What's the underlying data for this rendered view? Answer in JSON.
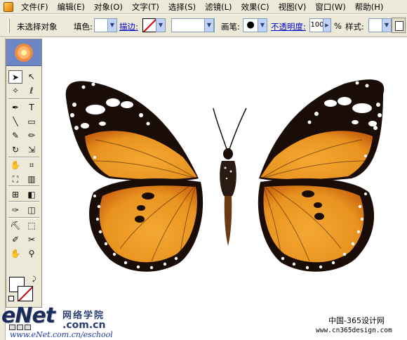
{
  "menubar": {
    "items": [
      "文件(F)",
      "编辑(E)",
      "对象(O)",
      "文字(T)",
      "选择(S)",
      "滤镜(L)",
      "效果(C)",
      "视图(V)",
      "窗口(W)",
      "帮助(H)"
    ]
  },
  "controlbar": {
    "selection_status": "未选择对象",
    "fill_label": "填色:",
    "stroke_label": "描边:",
    "brush_label": "画笔:",
    "brush_glyph": "●",
    "opacity_label": "不透明度:",
    "opacity_value": "100",
    "percent": "%",
    "style_label": "样式:"
  },
  "toolbox": {
    "tools": [
      {
        "name": "selection-tool-icon",
        "glyph": "➤"
      },
      {
        "name": "direct-selection-tool-icon",
        "glyph": "↖"
      },
      {
        "name": "magic-wand-tool-icon",
        "glyph": "✧"
      },
      {
        "name": "lasso-tool-icon",
        "glyph": "ℓ"
      },
      {
        "name": "pen-tool-icon",
        "glyph": "✒"
      },
      {
        "name": "type-tool-icon",
        "glyph": "T"
      },
      {
        "name": "line-tool-icon",
        "glyph": "╲"
      },
      {
        "name": "rectangle-tool-icon",
        "glyph": "▭"
      },
      {
        "name": "paintbrush-tool-icon",
        "glyph": "✎"
      },
      {
        "name": "pencil-tool-icon",
        "glyph": "✏"
      },
      {
        "name": "rotate-tool-icon",
        "glyph": "↻"
      },
      {
        "name": "scale-tool-icon",
        "glyph": "⇲"
      },
      {
        "name": "warp-tool-icon",
        "glyph": "✋"
      },
      {
        "name": "free-transform-tool-icon",
        "glyph": "⌗"
      },
      {
        "name": "symbol-sprayer-tool-icon",
        "glyph": "⛶"
      },
      {
        "name": "column-graph-tool-icon",
        "glyph": "▥"
      },
      {
        "name": "mesh-tool-icon",
        "glyph": "⊞"
      },
      {
        "name": "gradient-tool-icon",
        "glyph": "◧"
      },
      {
        "name": "eyedropper-tool-icon",
        "glyph": "✑"
      },
      {
        "name": "blend-tool-icon",
        "glyph": "◫"
      },
      {
        "name": "live-paint-bucket-tool-icon",
        "glyph": "⛏"
      },
      {
        "name": "live-paint-selection-tool-icon",
        "glyph": "⬚"
      },
      {
        "name": "slice-tool-icon",
        "glyph": "✐"
      },
      {
        "name": "scissors-tool-icon",
        "glyph": "✂"
      },
      {
        "name": "hand-tool-icon",
        "glyph": "✋"
      },
      {
        "name": "zoom-tool-icon",
        "glyph": "⚲"
      }
    ]
  },
  "watermark": {
    "enet": "eNet",
    "com_cn": ".com.cn",
    "school": "网络学院",
    "url": "www.eNet.com.cn/eschool",
    "cn365": "中国-365设计网",
    "cn365_url": "www.cn365design.com"
  },
  "colors": {
    "wing_orange": "#e8931f",
    "wing_dark": "#1a0c06",
    "wing_deep": "#c9610f",
    "chrome": "#ece9d8"
  }
}
